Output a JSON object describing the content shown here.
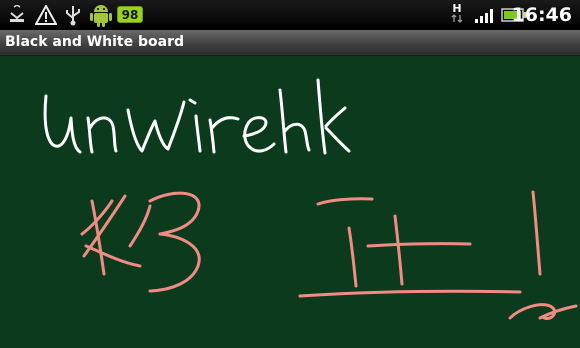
{
  "status_bar": {
    "left_icons": [
      "usb-debug-icon",
      "warning-icon",
      "usb-icon",
      "android-icon"
    ],
    "battery_badge": "98",
    "network_type": "H",
    "right_icons": [
      "data-arrows-icon",
      "signal-icon",
      "battery-icon"
    ],
    "time": "16:46"
  },
  "app": {
    "title": "Black and White board"
  },
  "board": {
    "background_color": "#0b3a1d",
    "handwriting": [
      {
        "text": "unwirehk",
        "color": "#ffffff"
      },
      {
        "text": "KB IT!",
        "color": "#f08c84"
      }
    ]
  }
}
